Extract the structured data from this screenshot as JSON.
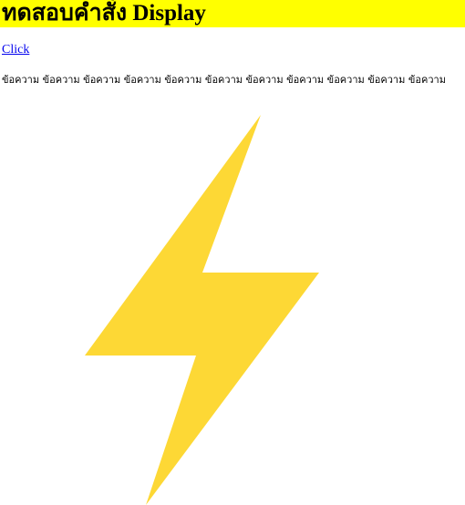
{
  "page": {
    "title": "ทดสอบคำสั่ง Display",
    "link_label": "Click",
    "paragraph": "ข้อความ ข้อความ ข้อความ ข้อความ ข้อความ ข้อความ ข้อความ ข้อความ ข้อความ ข้อความ ข้อความ"
  },
  "colors": {
    "title_background": "#FFFF00",
    "link": "#0000EE",
    "bolt_fill": "#FDD835"
  },
  "image": {
    "icon": "lightning-bolt-icon"
  }
}
